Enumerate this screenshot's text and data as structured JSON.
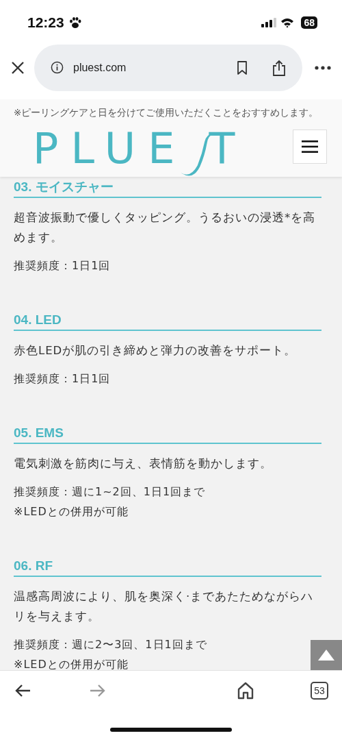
{
  "status_bar": {
    "time": "12:23",
    "battery": "68"
  },
  "browser_bar": {
    "url": "pluest.com"
  },
  "page": {
    "intro_note": "※ピーリングケアと日を分けてご使用いただくことをおすすめします。",
    "header": {
      "logo_before": "PLUE",
      "logo_after": "T"
    },
    "sections": [
      {
        "heading": "03. モイスチャー",
        "body": "超音波振動で優しくタッピング。うるおいの浸透*を高めます。",
        "frequency": "推奨頻度：1日1回"
      },
      {
        "heading": "04. LED",
        "body": "赤色LEDが肌の引き締めと弾力の改善をサポート。",
        "frequency": "推奨頻度：1日1回"
      },
      {
        "heading": "05. EMS",
        "body": "電気刺激を筋肉に与え、表情筋を動かします。",
        "frequency": "推奨頻度：週に1~2回、1日1回まで",
        "note": "※LEDとの併用が可能"
      },
      {
        "heading": "06. RF",
        "body": "温感高周波により、肌を奥深く·まであたためながらハリを与えます。",
        "frequency": "推奨頻度：週に2〜3回、1日1回まで",
        "note": "※LEDとの併用が可能"
      }
    ]
  },
  "toolbar": {
    "back": {
      "disabled": false
    },
    "forward": {
      "disabled": true
    },
    "tabs_count": "53"
  }
}
